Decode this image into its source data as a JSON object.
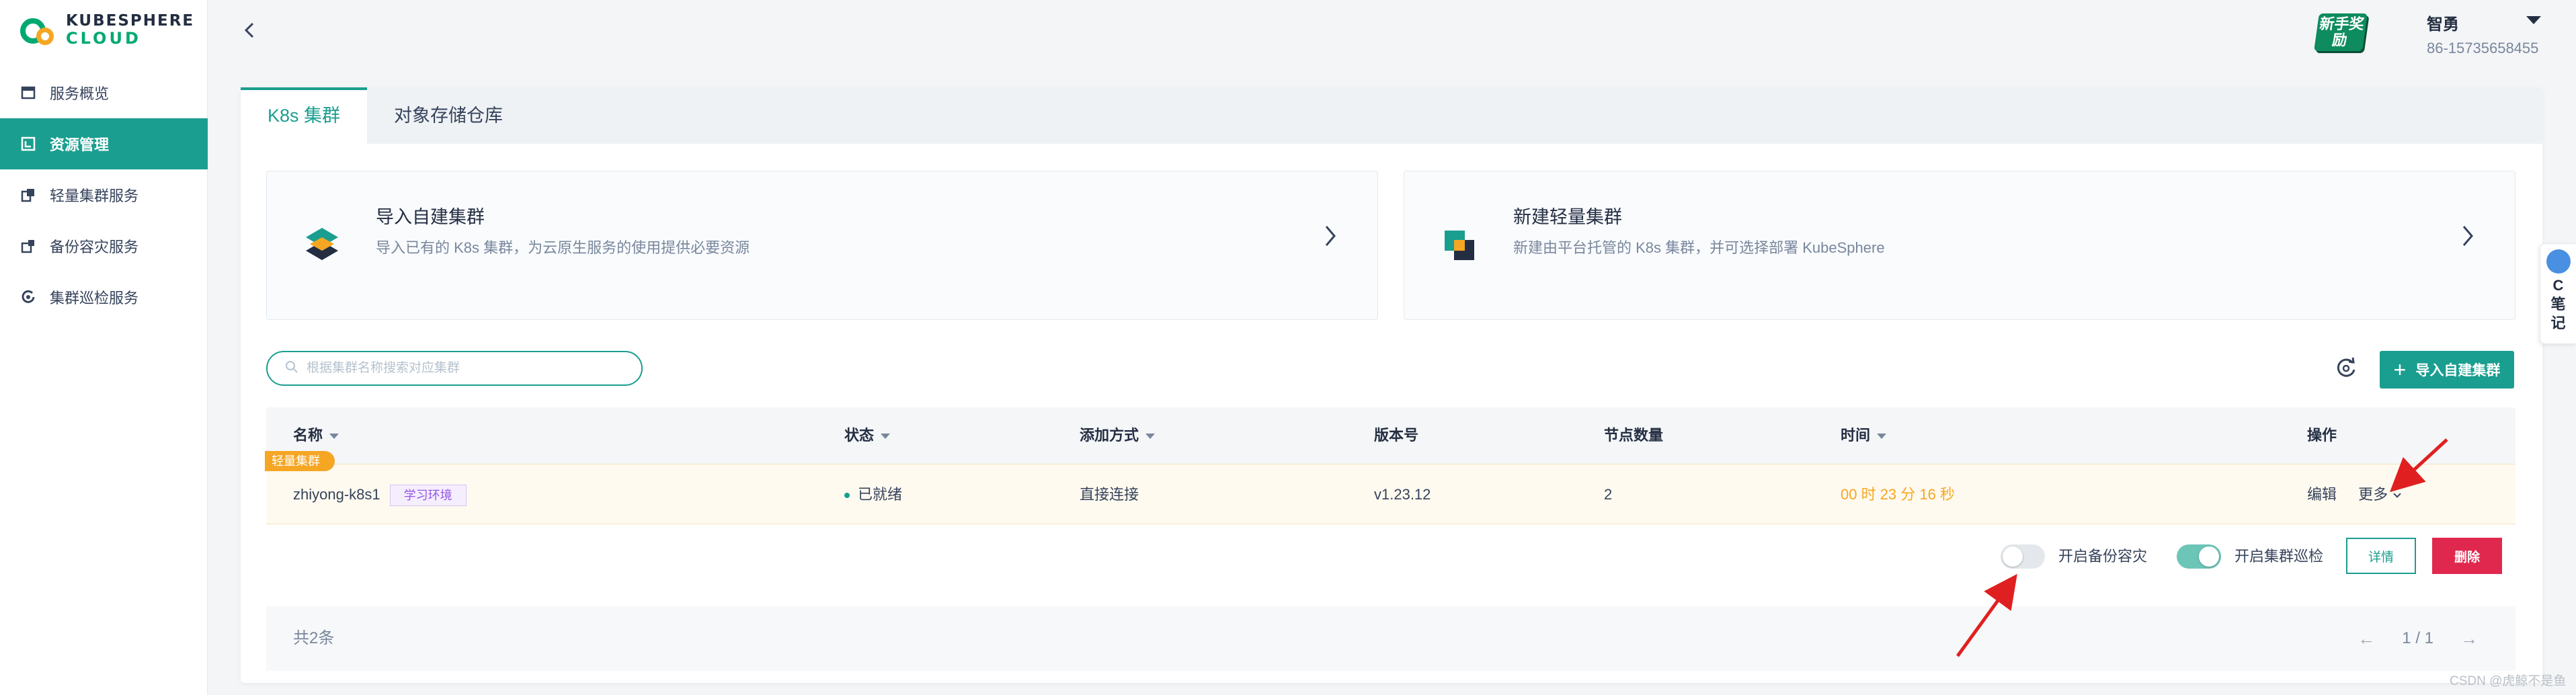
{
  "brand": {
    "line1": "KUBESPHERE",
    "line2": "CLOUD"
  },
  "sidebar": {
    "items": [
      {
        "label": "服务概览",
        "icon": "overview-icon",
        "active": false
      },
      {
        "label": "资源管理",
        "icon": "resource-icon",
        "active": true
      },
      {
        "label": "轻量集群服务",
        "icon": "light-cluster-icon",
        "active": false
      },
      {
        "label": "备份容灾服务",
        "icon": "backup-icon",
        "active": false
      },
      {
        "label": "集群巡检服务",
        "icon": "inspection-icon",
        "active": false
      }
    ]
  },
  "header": {
    "badge": "新手奖励",
    "user_name": "智勇",
    "user_phone": "86-15735658455"
  },
  "tabs": [
    {
      "label": "K8s 集群",
      "active": true
    },
    {
      "label": "对象存储仓库",
      "active": false
    }
  ],
  "cards": [
    {
      "title": "导入自建集群",
      "desc": "导入已有的 K8s 集群，为云原生服务的使用提供必要资源",
      "icon": "import-stack-icon"
    },
    {
      "title": "新建轻量集群",
      "desc": "新建由平台托管的 K8s 集群，并可选择部署 KubeSphere",
      "icon": "new-cluster-icon"
    }
  ],
  "toolbar": {
    "search_placeholder": "根据集群名称搜索对应集群",
    "import_button": "导入自建集群"
  },
  "table": {
    "headers": {
      "name": "名称",
      "status": "状态",
      "method": "添加方式",
      "version": "版本号",
      "nodes": "节点数量",
      "time": "时间",
      "ops": "操作"
    },
    "rows": [
      {
        "type_tag": "轻量集群",
        "name": "zhiyong-k8s1",
        "env_tag": "学习环境",
        "status": "已就绪",
        "method": "直接连接",
        "version": "v1.23.12",
        "nodes": "2",
        "time": "00 时 23 分 16 秒",
        "edit": "编辑",
        "more": "更多"
      }
    ],
    "row_actions": {
      "backup_label": "开启备份容灾",
      "backup_on": false,
      "inspect_label": "开启集群巡检",
      "inspect_on": true,
      "detail": "详情",
      "delete": "删除"
    },
    "footer": {
      "total": "共2条",
      "page": "1 / 1"
    }
  },
  "float_note": {
    "text_1": "C",
    "text_2": "笔",
    "text_3": "记"
  },
  "watermark": "CSDN @虎鲸不是鱼",
  "colors": {
    "accent": "#1a9e8f",
    "warning": "#f5a623",
    "danger": "#e0284f",
    "annotation": "#e02020"
  }
}
